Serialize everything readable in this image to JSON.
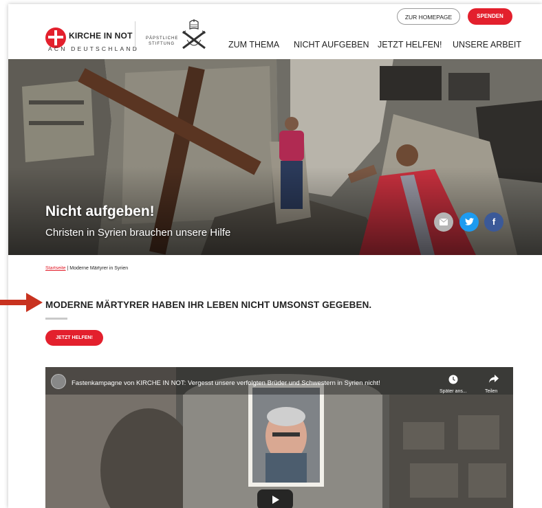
{
  "header": {
    "logo_name": "KIRCHE IN NOT",
    "logo_sub": "ACN DEUTSCHLAND",
    "papst_line1": "PÄPSTLICHE",
    "papst_line2": "STIFTUNG",
    "btn_home": "ZUR HOMEPAGE",
    "btn_donate": "SPENDEN",
    "nav": [
      "ZUM THEMA",
      "NICHT AUFGEBEN",
      "JETZT HELFEN!",
      "UNSERE ARBEIT"
    ]
  },
  "hero": {
    "title": "Nicht aufgeben!",
    "subtitle": "Christen in Syrien brauchen unsere Hilfe",
    "share_icons": [
      "mail-icon",
      "twitter-icon",
      "facebook-icon"
    ]
  },
  "breadcrumb": {
    "home": "Startseite",
    "separator": " | ",
    "current": "Moderne Märtyrer in Syrien"
  },
  "main": {
    "heading": "MODERNE MÄRTYRER HABEN IHR LEBEN NICHT UMSONST GEGEBEN.",
    "cta": "JETZT HELFEN!"
  },
  "video": {
    "title": "Fastenkampagne von KIRCHE IN NOT: Vergesst unsere verfolgten Brüder und Schwestern in Syrien nicht!",
    "watch_later": "Später ans...",
    "share": "Teilen"
  },
  "colors": {
    "brand_red": "#e3202d",
    "twitter": "#1d9bf0",
    "facebook": "#3b5998"
  }
}
